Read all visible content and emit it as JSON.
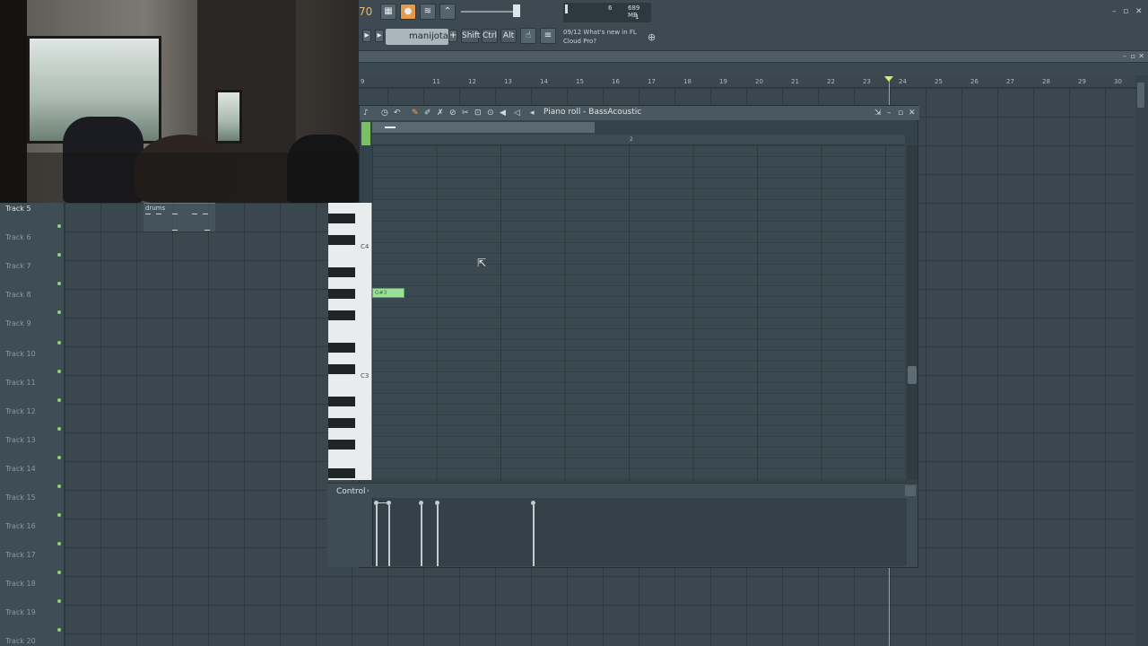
{
  "toolbar": {
    "bpm_fragment": "70",
    "pattern_name": "manijota",
    "shift_label": "Shift",
    "ctrl_label": "Ctrl",
    "alt_label": "Alt",
    "news_date": "09/12",
    "news_text": "What's new in FL Cloud Pro?",
    "cpu_value": "6",
    "memory": "689 MB",
    "poly": "1"
  },
  "playlist": {
    "ruler": [
      "9",
      "11",
      "12",
      "13",
      "14",
      "15",
      "16",
      "17",
      "18",
      "19",
      "20",
      "21",
      "22",
      "23",
      "24",
      "25",
      "26",
      "27",
      "28",
      "29",
      "30"
    ],
    "tracks": [
      "Track 5",
      "Track 6",
      "Track 7",
      "Track 8",
      "Track 9",
      "Track 10",
      "Track 11",
      "Track 12",
      "Track 13",
      "Track 14",
      "Track 15",
      "Track 16",
      "Track 17",
      "Track 18",
      "Track 19",
      "Track 20"
    ],
    "clip_name": "drums"
  },
  "piano_roll": {
    "title": "Piano roll - BassAcoustic",
    "ruler_mark": "2",
    "key_c4": "C4",
    "key_c3": "C3",
    "note_label": "G#3",
    "control_label": "Control"
  },
  "colors": {
    "note": "#9be097",
    "playhead_marker": "#d8f06a",
    "track_led": "#8fd07a"
  }
}
